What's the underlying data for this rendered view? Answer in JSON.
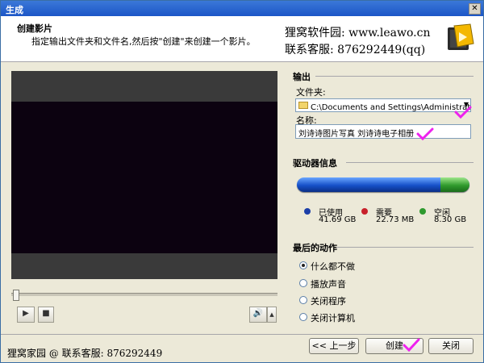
{
  "window": {
    "title": "生成"
  },
  "header": {
    "title": "创建影片",
    "subtitle": "指定输出文件夹和文件名,然后按\"创建\"来创建一个影片。",
    "brand_line1": "狸窝软件园: www.leawo.cn",
    "brand_line2": "联系客服: 876292449(qq)"
  },
  "output": {
    "section_title": "输出",
    "folder_label": "文件夹:",
    "folder_value": "C:\\Documents and Settings\\Administrator\\桌面",
    "name_label": "名称:",
    "name_value": "刘诗诗图片写真 刘诗诗电子相册"
  },
  "drive": {
    "section_title": "驱动器信息",
    "used_label": "已使用",
    "used_value": "41.69 GB",
    "needed_label": "需要",
    "needed_value": "22.73 MB",
    "free_label": "空闲",
    "free_value": "8.30 GB",
    "used_fraction": 0.834,
    "colors": {
      "used": "#1c3fa8",
      "needed": "#c8202a",
      "free": "#2e9a2e"
    }
  },
  "final_action": {
    "section_title": "最后的动作",
    "options": [
      {
        "label": "什么都不做",
        "selected": true
      },
      {
        "label": "播放声音",
        "selected": false
      },
      {
        "label": "关闭程序",
        "selected": false
      },
      {
        "label": "关闭计算机",
        "selected": false
      }
    ]
  },
  "player": {
    "progress": 0.0,
    "play_icon": "play-icon",
    "stop_icon": "stop-icon",
    "volume_icon": "speaker-icon"
  },
  "footer": {
    "text": "狸窝家园 @ 联系客服: 876292449",
    "back_label": "<< 上一步",
    "create_label": "创建",
    "close_label": "关闭"
  },
  "accent": {
    "annotation": "#ee22ee"
  }
}
